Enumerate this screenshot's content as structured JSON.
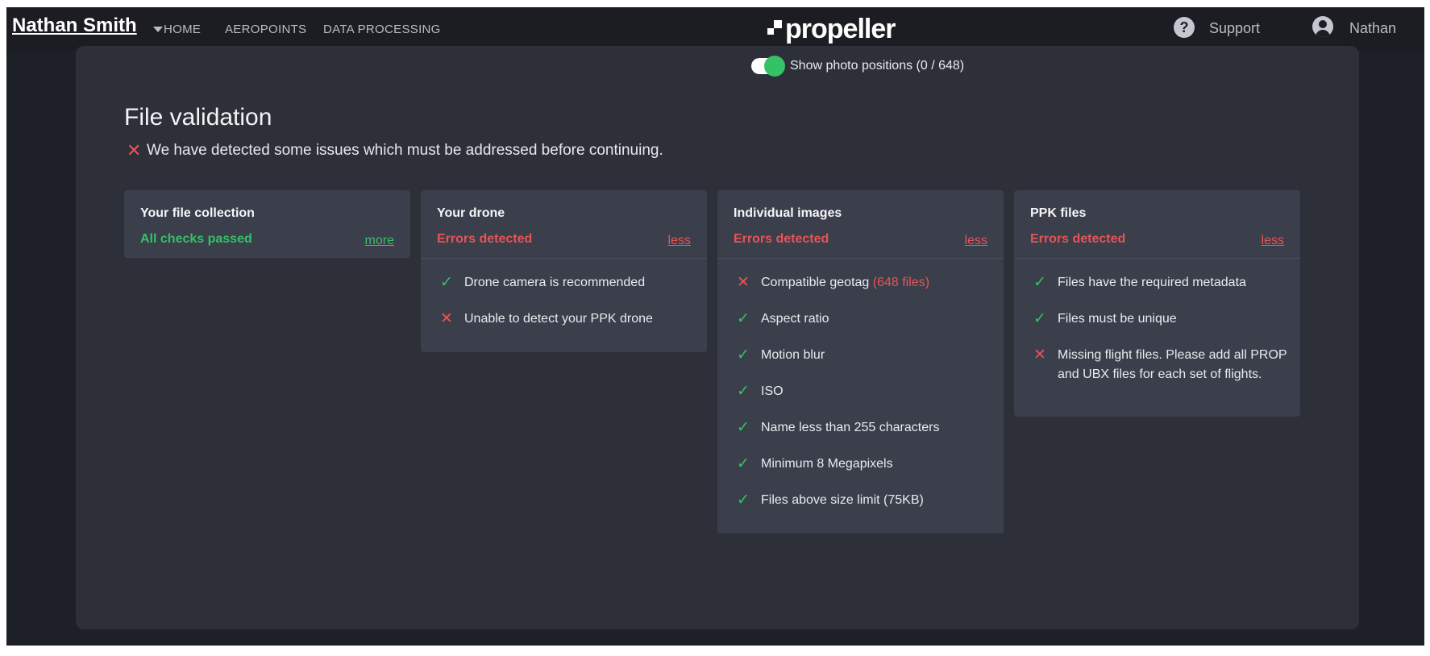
{
  "header": {
    "user_name": "Nathan Smith",
    "nav": [
      "HOME",
      "AEROPOINTS",
      "DATA PROCESSING"
    ],
    "logo_text": "propeller",
    "support_label": "Support",
    "account_label": "Nathan"
  },
  "panel": {
    "toggle_label": "Show photo positions (0 / 648)",
    "toggle_on": true,
    "title": "File validation",
    "warning": "We have detected some issues which must be addressed before continuing."
  },
  "cards": [
    {
      "title": "Your file collection",
      "status": "All checks passed",
      "link": "more",
      "items": []
    },
    {
      "title": "Your drone",
      "status": "Errors detected",
      "link": "less",
      "items": [
        {
          "ok": true,
          "text": "Drone camera is recommended"
        },
        {
          "ok": false,
          "text": "Unable to detect your PPK drone"
        }
      ]
    },
    {
      "title": "Individual images",
      "status": "Errors detected",
      "link": "less",
      "items": [
        {
          "ok": false,
          "text": "Compatible geotag",
          "count": "(648 files)"
        },
        {
          "ok": true,
          "text": "Aspect ratio"
        },
        {
          "ok": true,
          "text": "Motion blur"
        },
        {
          "ok": true,
          "text": "ISO"
        },
        {
          "ok": true,
          "text": "Name less than 255 characters"
        },
        {
          "ok": true,
          "text": "Minimum 8 Megapixels"
        },
        {
          "ok": true,
          "text": "Files above size limit (75KB)"
        }
      ]
    },
    {
      "title": "PPK files",
      "status": "Errors detected",
      "link": "less",
      "items": [
        {
          "ok": true,
          "text": "Files have the required metadata"
        },
        {
          "ok": true,
          "text": "Files must be unique"
        },
        {
          "ok": false,
          "text": "Missing flight files. Please add all PROP and UBX files for each set of flights."
        }
      ]
    }
  ],
  "colors": {
    "ok": "#35c165",
    "error": "#e85454",
    "card_bg": "#3b3e4b",
    "panel_bg": "#2d3039"
  },
  "icons": {
    "check": "check-icon",
    "cross": "cross-icon",
    "help": "help-circle-icon",
    "account": "account-circle-icon"
  }
}
